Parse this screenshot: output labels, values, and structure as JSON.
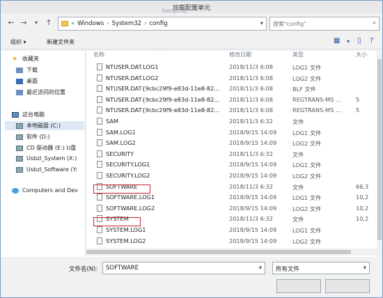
{
  "window": {
    "title": "加载配置单元",
    "watermark": "bengzhiji"
  },
  "address": {
    "prefix": "«",
    "crumbs": [
      "Windows",
      "System32",
      "config"
    ],
    "search_placeholder": "搜索\"config\""
  },
  "toolbar": {
    "organize": "组织 ▾",
    "new_folder": "新建文件夹"
  },
  "nav": {
    "favorites": "收藏夹",
    "downloads": "下载",
    "desktop": "桌面",
    "recent": "最近访问的位置",
    "this_pc": "这台电脑",
    "local_disk": "本地磁盘 (C:)",
    "software_d": "软件 (D:)",
    "cd_drive": "CD 驱动器 (E:) U盘",
    "usbzl_system": "Usbzl_System (X:)",
    "usbzl_software": "Usbzl_Software (Y:",
    "network": "Computers and Dev"
  },
  "columns": {
    "name": "名称",
    "date": "修改日期",
    "type": "类型",
    "size": "大小"
  },
  "files": [
    {
      "name": "NTUSER.DAT.LOG1",
      "date": "2018/11/3 6:08",
      "type": "LOG1 文件",
      "size": ""
    },
    {
      "name": "NTUSER.DAT.LOG2",
      "date": "2018/11/3 6:08",
      "type": "LOG2 文件",
      "size": ""
    },
    {
      "name": "NTUSER.DAT{9cbc29f9-e83d-11e8-82...",
      "date": "2018/11/3 6:08",
      "type": "BLF 文件",
      "size": ""
    },
    {
      "name": "NTUSER.DAT{9cbc29f9-e83d-11e8-82...",
      "date": "2018/11/3 6:08",
      "type": "REGTRANS-MS ...",
      "size": "5"
    },
    {
      "name": "NTUSER.DAT{9cbc29f9-e83d-11e8-82...",
      "date": "2018/11/3 6:08",
      "type": "REGTRANS-MS ...",
      "size": "5"
    },
    {
      "name": "SAM",
      "date": "2018/11/3 6:32",
      "type": "文件",
      "size": ""
    },
    {
      "name": "SAM.LOG1",
      "date": "2018/9/15 14:09",
      "type": "LOG1 文件",
      "size": ""
    },
    {
      "name": "SAM.LOG2",
      "date": "2018/9/15 14:09",
      "type": "LOG2 文件",
      "size": ""
    },
    {
      "name": "SECURITY",
      "date": "2018/11/3 6:32",
      "type": "文件",
      "size": ""
    },
    {
      "name": "SECURITY.LOG1",
      "date": "2018/9/15 14:09",
      "type": "LOG1 文件",
      "size": ""
    },
    {
      "name": "SECURITY.LOG2",
      "date": "2018/9/15 14:09",
      "type": "LOG2 文件",
      "size": ""
    },
    {
      "name": "SOFTWARE",
      "date": "2018/11/3 6:32",
      "type": "文件",
      "size": "66,3"
    },
    {
      "name": "SOFTWARE.LOG1",
      "date": "2018/9/15 14:09",
      "type": "LOG1 文件",
      "size": "10,2"
    },
    {
      "name": "SOFTWARE.LOG2",
      "date": "2018/9/15 14:09",
      "type": "LOG2 文件",
      "size": "10,2"
    },
    {
      "name": "SYSTEM",
      "date": "2018/11/3 6:32",
      "type": "文件",
      "size": "10,2"
    },
    {
      "name": "SYSTEM.LOG1",
      "date": "2018/9/15 14:09",
      "type": "LOG1 文件",
      "size": ""
    },
    {
      "name": "SYSTEM.LOG2",
      "date": "2018/9/15 14:09",
      "type": "LOG2 文件",
      "size": ""
    }
  ],
  "bottom": {
    "filename_label": "文件名(N):",
    "filename_value": "SOFTWARE",
    "filetype_value": "所有文件"
  },
  "colors": {
    "highlight_box": "#c8202a",
    "selected_nav": "#dfe9f5"
  }
}
